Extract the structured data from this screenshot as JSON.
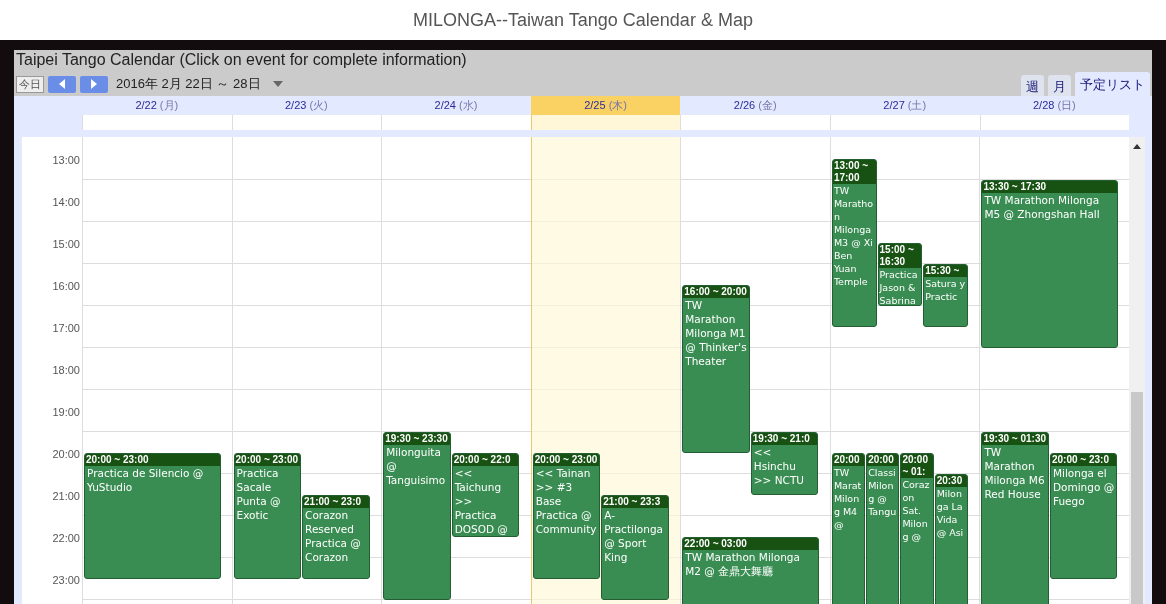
{
  "page_title": "MILONGA--Taiwan Tango Calendar & Map",
  "calendar": {
    "title": "Taipei Tango Calendar (Click on event for complete information)",
    "today_button": "今日",
    "date_range": "2016年 2月 22日 ～ 28日",
    "view_tabs": [
      {
        "label": "週",
        "selected": false
      },
      {
        "label": "月",
        "selected": false
      },
      {
        "label": "予定リスト",
        "selected": true
      }
    ],
    "hours": [
      "13:00",
      "14:00",
      "15:00",
      "16:00",
      "17:00",
      "18:00",
      "19:00",
      "20:00",
      "21:00",
      "22:00",
      "23:00"
    ],
    "days": [
      {
        "date": "2/22",
        "weekday": "(月)",
        "today": false,
        "events": [
          {
            "time": "20:00 ~ 23:00",
            "title": "Practica de Silencio @ YuStudio"
          }
        ]
      },
      {
        "date": "2/23",
        "weekday": "(火)",
        "today": false,
        "events": [
          {
            "time": "20:00 ~ 23:00",
            "title": "Practica Sacale Punta @ Exotic"
          },
          {
            "time": "21:00 ~ 23:0",
            "title": "Corazon Reserved Practica @ Corazon"
          }
        ]
      },
      {
        "date": "2/24",
        "weekday": "(水)",
        "today": false,
        "events": [
          {
            "time": "19:30 ~ 23:30",
            "title": "Milonguita @ Tanguisimo"
          },
          {
            "time": "20:00 ~ 22:0",
            "title": "<< Taichung >> Practica DOSOD @"
          }
        ]
      },
      {
        "date": "2/25",
        "weekday": "(木)",
        "today": true,
        "events": [
          {
            "time": "20:00 ~ 23:00",
            "title": "<< Tainan >> #3 Base Practica @ Community"
          },
          {
            "time": "21:00 ~ 23:3",
            "title": "A-Practilonga @ Sport King"
          }
        ]
      },
      {
        "date": "2/26",
        "weekday": "(金)",
        "today": false,
        "events": [
          {
            "time": "16:00 ~ 20:00",
            "title": "TW Marathon Milonga M1 @ Thinker's Theater"
          },
          {
            "time": "19:30 ~ 21:0",
            "title": "<< Hsinchu >> NCTU"
          },
          {
            "time": "22:00 ~ 03:00",
            "title": "TW Marathon Milonga M2 @ 金鼎大舞廳"
          }
        ]
      },
      {
        "date": "2/27",
        "weekday": "(土)",
        "today": false,
        "events": [
          {
            "time": "13:00 ~ 17:00",
            "title": "TW Marathon Milonga M3 @ Xi Ben Yuan Temple"
          },
          {
            "time": "15:00 ~ 16:30",
            "title": "Practica Jason & Sabrina"
          },
          {
            "time": "15:30 ~",
            "title": "Satura y Practic"
          },
          {
            "time": "20:00",
            "title": "TW Marat Milong M4 @"
          },
          {
            "time": "20:00",
            "title": "Classi Milong @ Tangu"
          },
          {
            "time": "20:00 ~ 01:",
            "title": "Corazon Sat. Milong @"
          },
          {
            "time": "20:30",
            "title": "Milon ga La Vida @ Asi"
          }
        ]
      },
      {
        "date": "2/28",
        "weekday": "(日)",
        "today": false,
        "events": [
          {
            "time": "13:30 ~ 17:30",
            "title": "TW Marathon Milonga M5 @ Zhongshan Hall"
          },
          {
            "time": "19:30 ~ 01:30",
            "title": "TW Marathon Milonga M6 Red House"
          },
          {
            "time": "20:00 ~ 23:0",
            "title": "Milonga el Domingo @ Fuego"
          }
        ]
      }
    ]
  }
}
